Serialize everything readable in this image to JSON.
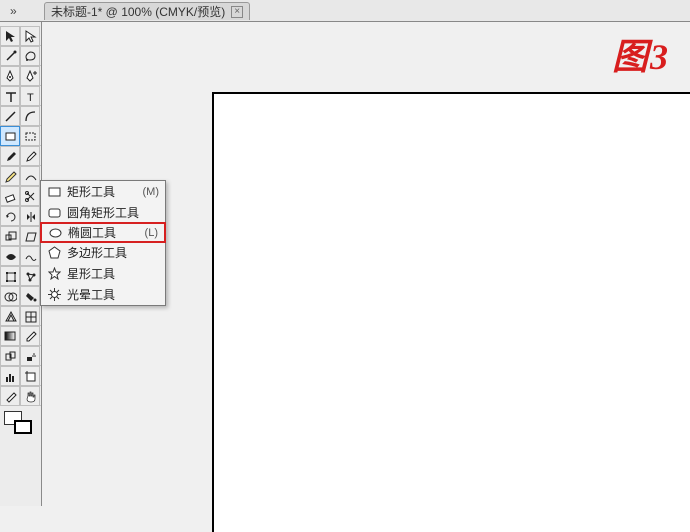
{
  "tab": {
    "title": "未标题-1* @ 100% (CMYK/预览)",
    "close_glyph": "×"
  },
  "chevron": {
    "label": "»"
  },
  "figure": {
    "label": "图3"
  },
  "flyout": {
    "items": [
      {
        "label": "矩形工具",
        "shortcut": "(M)",
        "icon": "rectangle-icon"
      },
      {
        "label": "圆角矩形工具",
        "shortcut": "",
        "icon": "rounded-rectangle-icon"
      },
      {
        "label": "椭圆工具",
        "shortcut": "(L)",
        "icon": "ellipse-icon",
        "highlight": true
      },
      {
        "label": "多边形工具",
        "shortcut": "",
        "icon": "polygon-icon"
      },
      {
        "label": "星形工具",
        "shortcut": "",
        "icon": "star-icon"
      },
      {
        "label": "光晕工具",
        "shortcut": "",
        "icon": "flare-icon"
      }
    ]
  },
  "colors": {
    "highlight": "#d62020",
    "fig_label": "#d81e1e"
  }
}
